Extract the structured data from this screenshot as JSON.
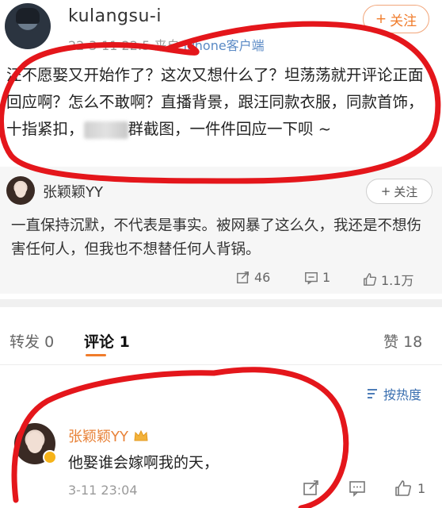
{
  "post": {
    "username": "kulangsu-i",
    "date": "22-3-11 22:5",
    "source_prefix": "来自",
    "source_device": "iPhone客户端",
    "follow_label": "关注",
    "text_part1": "汪不愿娶又开始作了？这次又想什么了？坦荡荡就开评论正面回应啊？怎么不敢啊？直播背景，跟汪同款衣服，同款首饰，十指紧扣，",
    "text_part2": "群截图，一件件回应一下呗 ~"
  },
  "repost": {
    "username": "张颖颖YY",
    "follow_label": "关注",
    "text": "一直保持沉默，不代表是事实。被网暴了这么久，我还是不想伤害任何人，但我也不想替任何人背锅。",
    "shares": "46",
    "comments": "1",
    "likes": "1.1万"
  },
  "tabs": {
    "repost_label": "转发",
    "repost_count": "0",
    "comment_label": "评论",
    "comment_count": "1",
    "like_label": "赞",
    "like_count": "18"
  },
  "sort": {
    "label": "按热度"
  },
  "comment": {
    "username": "张颖颖YY",
    "text": "他娶谁会嫁啊我的天，",
    "time": "3-11 23:04",
    "likes": "1"
  },
  "colors": {
    "accent": "#f07c2b",
    "link": "#3a6fb0",
    "annotation": "#e4161b"
  }
}
